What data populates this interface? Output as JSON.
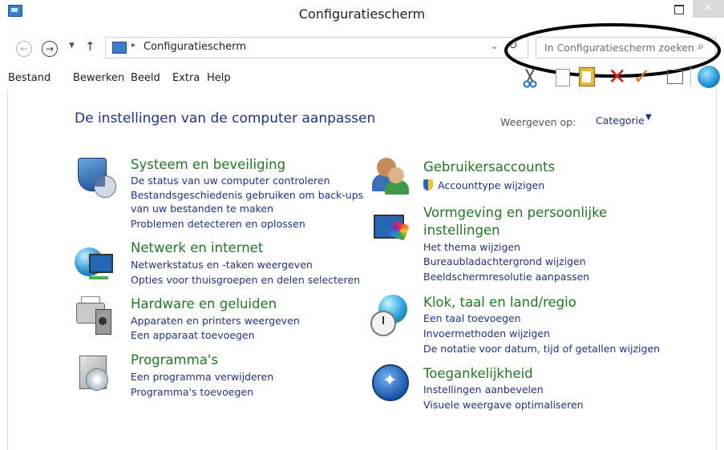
{
  "window": {
    "title": "Configuratiescherm",
    "close_glyph": "✕"
  },
  "address": {
    "breadcrumb": "Configuratiescherm",
    "separator": "▸",
    "dropdown_glyph": "⌄",
    "refresh_glyph": "↻"
  },
  "nav": {
    "back_glyph": "←",
    "forward_glyph": "→",
    "recent_glyph": "▼",
    "up_glyph": "↑"
  },
  "search": {
    "placeholder": "In Configuratiescherm zoeken",
    "icon_glyph": "⌕"
  },
  "menu": [
    "Bestand",
    "Bewerken",
    "Beeld",
    "Extra",
    "Help"
  ],
  "toolbar": {
    "delete_glyph": "✕",
    "check_glyph": "✓",
    "cut_glyph": "✂"
  },
  "main": {
    "heading": "De instellingen van de computer aanpassen",
    "view_label": "Weergeven op:",
    "view_value": "Categorie",
    "view_caret": "▼"
  },
  "categories": {
    "security": {
      "title": "Systeem en beveiliging",
      "links": [
        "De status van uw computer controleren",
        "Bestandsgeschiedenis gebruiken om back-ups",
        "van uw bestanden te maken",
        "Problemen detecteren en oplossen"
      ]
    },
    "network": {
      "title": "Netwerk en internet",
      "links": [
        "Netwerkstatus en -taken weergeven",
        "Opties voor thuisgroepen en delen selecteren"
      ]
    },
    "hardware": {
      "title": "Hardware en geluiden",
      "links": [
        "Apparaten en printers weergeven",
        "Een apparaat toevoegen"
      ]
    },
    "programs": {
      "title": "Programma's",
      "links": [
        "Een programma verwijderen",
        "Programma's toevoegen"
      ]
    },
    "users": {
      "title": "Gebruikersaccounts",
      "links": [
        "Accounttype wijzigen"
      ]
    },
    "appearance": {
      "title_line1": "Vormgeving en persoonlijke",
      "title_line2": "instellingen",
      "links": [
        "Het thema wijzigen",
        "Bureaubladachtergrond wijzigen",
        "Beeldschermresolutie aanpassen"
      ]
    },
    "clock": {
      "title": "Klok, taal en land/regio",
      "links": [
        "Een taal toevoegen",
        "Invoermethoden wijzigen",
        "De notatie voor datum, tijd of getallen wijzigen"
      ]
    },
    "access": {
      "title": "Toegankelijkheid",
      "links": [
        "Instellingen aanbevelen",
        "Visuele weergave optimaliseren"
      ]
    }
  }
}
